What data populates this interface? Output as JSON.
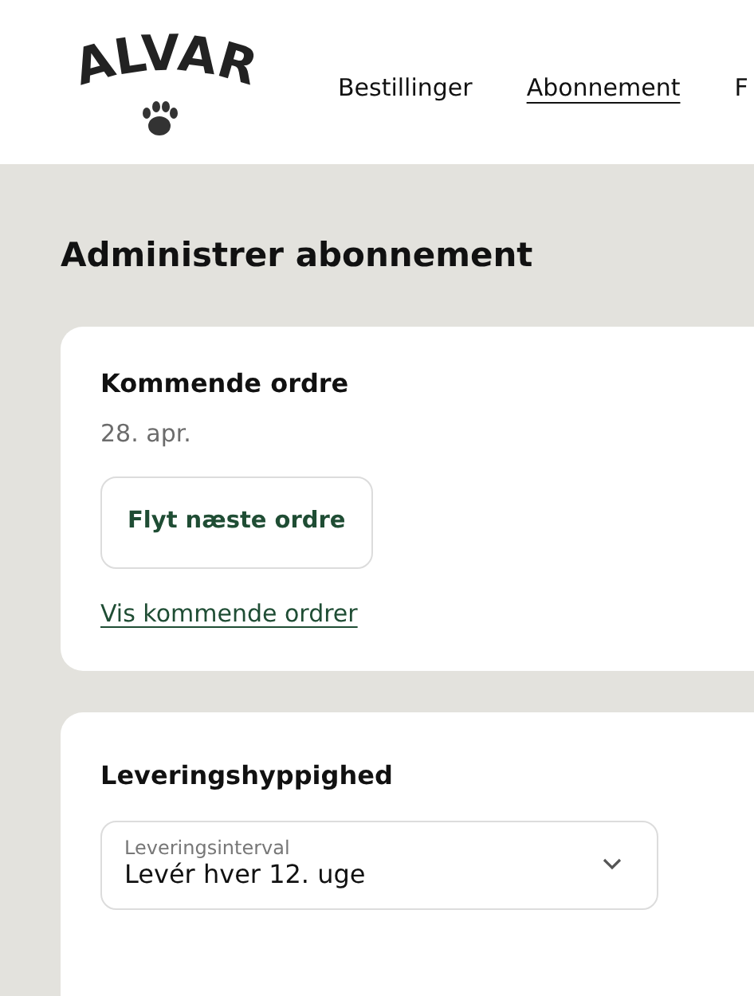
{
  "header": {
    "logo": "ALVAR",
    "nav": [
      {
        "label": "Bestillinger",
        "selected": false
      },
      {
        "label": "Abonnement",
        "selected": true
      },
      {
        "label": "F",
        "selected": false
      }
    ]
  },
  "page_title": "Administrer abonnement",
  "upcoming_order": {
    "title": "Kommende ordre",
    "date": "28. apr.",
    "button": "Flyt næste ordre",
    "link": "Vis kommende ordrer"
  },
  "delivery_frequency": {
    "title": "Leveringshyppighed",
    "select": {
      "label": "Leveringsinterval",
      "value": "Levér hver 12. uge"
    }
  }
}
